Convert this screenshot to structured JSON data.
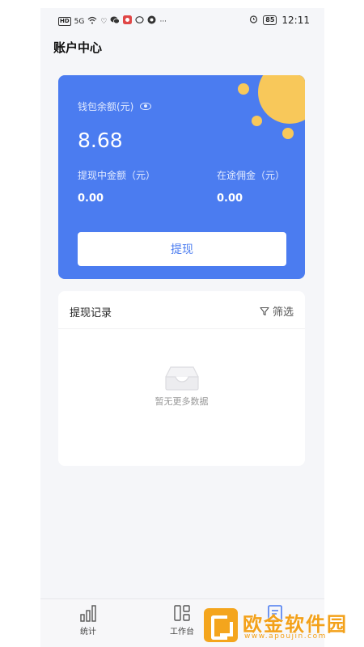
{
  "status_bar": {
    "hd_badge": "HD",
    "signal": "5G",
    "battery": "85",
    "time": "12:11"
  },
  "page": {
    "title": "账户中心"
  },
  "wallet": {
    "balance_label": "钱包余额(元)",
    "balance_value": "8.68",
    "withdrawing_label": "提现中金额（元）",
    "withdrawing_value": "0.00",
    "commission_label": "在途佣金（元）",
    "commission_value": "0.00",
    "withdraw_button": "提现",
    "colors": {
      "card": "#4b7cf0",
      "sun": "#f8c85a"
    }
  },
  "records": {
    "title": "提现记录",
    "filter_label": "筛选",
    "empty_text": "暂无更多数据"
  },
  "tabbar": {
    "items": [
      {
        "label": "统计",
        "icon": "bar-chart-icon"
      },
      {
        "label": "工作台",
        "icon": "grid-icon"
      },
      {
        "label": "",
        "icon": "document-icon"
      }
    ]
  },
  "watermark": {
    "text": "欧金软件园",
    "url": "www.apoujin.com",
    "color": "#f3a11a"
  }
}
